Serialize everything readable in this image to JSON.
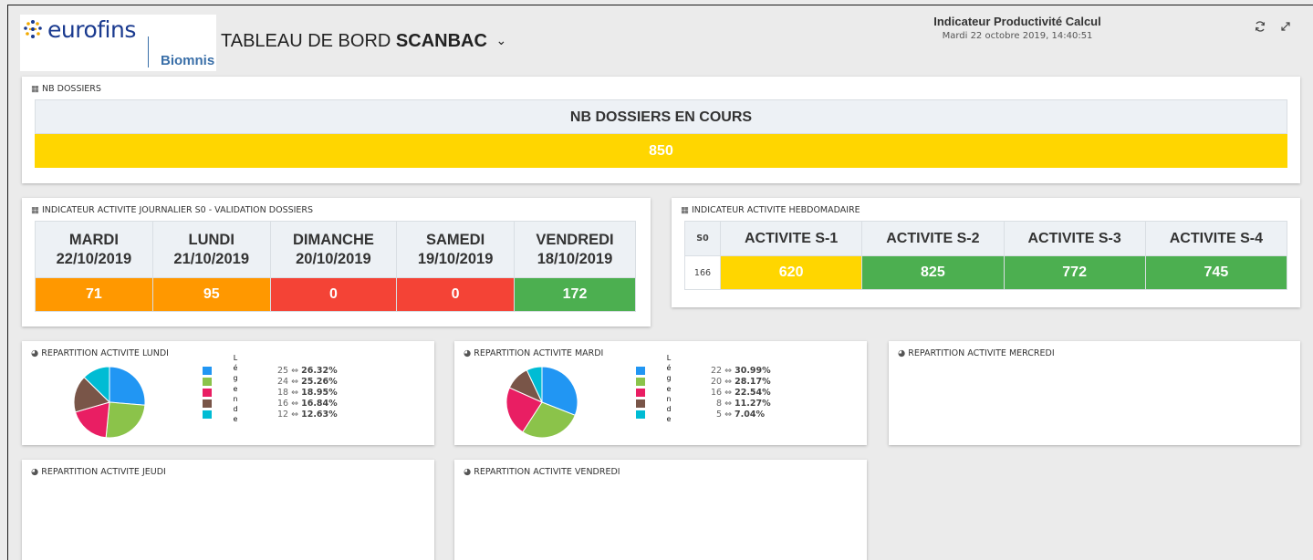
{
  "header": {
    "logo_text": "eurofins",
    "logo_sub": "Biomnis",
    "title_prefix": "TABLEAU DE BORD",
    "title_bold": "SCANBAC",
    "title_chevron": "⌄",
    "report_name": "Indicateur Productivité Calcul",
    "datetime": "Mardi 22 octobre 2019, 14:40:51",
    "refresh_icon": "refresh-icon",
    "expand_icon": "expand-icon"
  },
  "nb_dossiers": {
    "panel_title": "NB DOSSIERS",
    "header": "NB DOSSIERS EN COURS",
    "value": "850",
    "color": "#ffd600"
  },
  "daily": {
    "panel_title": "INDICATEUR ACTIVITE JOURNALIER S0 - VALIDATION DOSSIERS",
    "columns": [
      {
        "day": "MARDI",
        "date": "22/10/2019",
        "value": "71",
        "color": "#ff9800"
      },
      {
        "day": "LUNDI",
        "date": "21/10/2019",
        "value": "95",
        "color": "#ff9800"
      },
      {
        "day": "DIMANCHE",
        "date": "20/10/2019",
        "value": "0",
        "color": "#f44336"
      },
      {
        "day": "SAMEDI",
        "date": "19/10/2019",
        "value": "0",
        "color": "#f44336"
      },
      {
        "day": "VENDREDI",
        "date": "18/10/2019",
        "value": "172",
        "color": "#4caf50"
      }
    ]
  },
  "weekly": {
    "panel_title": "INDICATEUR ACTIVITE HEBDOMADAIRE",
    "s0_label": "S0",
    "s0_value": "166",
    "columns": [
      {
        "label": "ACTIVITE S-1",
        "value": "620",
        "color": "#ffd600"
      },
      {
        "label": "ACTIVITE S-2",
        "value": "825",
        "color": "#4caf50"
      },
      {
        "label": "ACTIVITE S-3",
        "value": "772",
        "color": "#4caf50"
      },
      {
        "label": "ACTIVITE S-4",
        "value": "745",
        "color": "#4caf50"
      }
    ]
  },
  "pies": {
    "lundi": {
      "title": "REPARTITION ACTIVITE LUNDI",
      "legend_word": "Légende",
      "rows": [
        {
          "count": "25",
          "pct": "26.32%",
          "color": "#2196f3"
        },
        {
          "count": "24",
          "pct": "25.26%",
          "color": "#8bc34a"
        },
        {
          "count": "18",
          "pct": "18.95%",
          "color": "#e91e63"
        },
        {
          "count": "16",
          "pct": "16.84%",
          "color": "#795548"
        },
        {
          "count": "12",
          "pct": "12.63%",
          "color": "#00bcd4"
        }
      ]
    },
    "mardi": {
      "title": "REPARTITION ACTIVITE MARDI",
      "legend_word": "Légende",
      "rows": [
        {
          "count": "22",
          "pct": "30.99%",
          "color": "#2196f3"
        },
        {
          "count": "20",
          "pct": "28.17%",
          "color": "#8bc34a"
        },
        {
          "count": "16",
          "pct": "22.54%",
          "color": "#e91e63"
        },
        {
          "count": "8",
          "pct": "11.27%",
          "color": "#795548"
        },
        {
          "count": "5",
          "pct": "7.04%",
          "color": "#00bcd4"
        }
      ]
    },
    "mercredi": {
      "title": "REPARTITION ACTIVITE MERCREDI"
    },
    "jeudi": {
      "title": "REPARTITION ACTIVITE JEUDI"
    },
    "vendredi": {
      "title": "REPARTITION ACTIVITE VENDREDI"
    }
  },
  "icons": {
    "table_icon": "table-icon",
    "pie_icon": "pie-chart-icon"
  }
}
